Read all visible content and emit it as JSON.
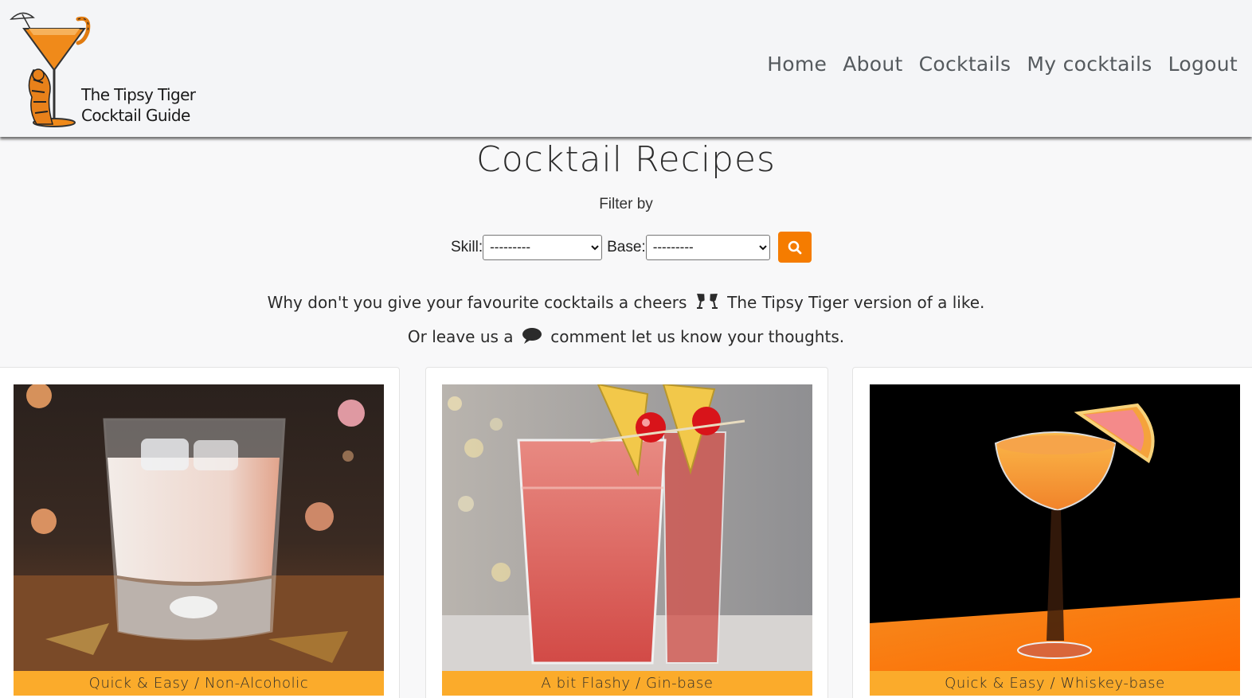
{
  "brand": {
    "line1": "The Tipsy Tiger",
    "line2": "Cocktail Guide"
  },
  "nav": {
    "items": [
      "Home",
      "About",
      "Cocktails",
      "My cocktails",
      "Logout"
    ]
  },
  "main": {
    "title": "Cocktail Recipes",
    "filter_label": "Filter by",
    "skill_label": "Skill:",
    "skill_selected": "---------",
    "base_label": "Base:",
    "base_selected": "---------",
    "search_icon": "search-icon",
    "intro_line1_a": "Why don't you give your favourite cocktails a cheers",
    "intro_line1_b": "The Tipsy Tiger version of a like.",
    "intro_line2_a": "Or leave us a",
    "intro_line2_b": "comment let us know your thoughts."
  },
  "cards": [
    {
      "tag": "Quick & Easy / Non-Alcoholic"
    },
    {
      "tag": "A bit Flashy / Gin-base"
    },
    {
      "tag": "Quick & Easy / Whiskey-base"
    }
  ],
  "colors": {
    "accent": "#f57c00",
    "tag_bg": "#fbab2b",
    "nav_text": "#555a5e"
  }
}
